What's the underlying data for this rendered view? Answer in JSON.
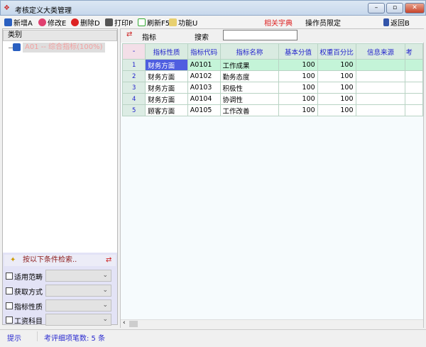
{
  "window": {
    "title": "考核定义大类管理"
  },
  "toolbar": {
    "add": "新增A",
    "edit": "修改E",
    "delete": "删除D",
    "print": "打印P",
    "refresh": "刷新F5",
    "func": "功能U",
    "dict": "相关字典",
    "operator": "操作员限定",
    "back": "返回B"
  },
  "left": {
    "header": "类别",
    "tree_item": "A01 -- 综合指标(100%)",
    "search_title": "按以下条件检索..",
    "filters": [
      {
        "label": "适用范畴"
      },
      {
        "label": "获取方式"
      },
      {
        "label": "指标性质"
      },
      {
        "label": "工资科目"
      }
    ]
  },
  "right": {
    "label": "指标",
    "search_label": "搜索",
    "search_value": ""
  },
  "grid": {
    "corner": "-",
    "columns": [
      "指标性质",
      "指标代码",
      "指标名称",
      "基本分值",
      "权重百分比",
      "信息来源",
      "考"
    ],
    "rows": [
      {
        "idx": "1",
        "nature": "财务方面",
        "code": "A0101",
        "name": "工作成果",
        "score": "100",
        "weight": "100",
        "source": ""
      },
      {
        "idx": "2",
        "nature": "财务方面",
        "code": "A0102",
        "name": "勤务态度",
        "score": "100",
        "weight": "100",
        "source": ""
      },
      {
        "idx": "3",
        "nature": "财务方面",
        "code": "A0103",
        "name": "积极性",
        "score": "100",
        "weight": "100",
        "source": ""
      },
      {
        "idx": "4",
        "nature": "财务方面",
        "code": "A0104",
        "name": "协调性",
        "score": "100",
        "weight": "100",
        "source": ""
      },
      {
        "idx": "5",
        "nature": "顾客方面",
        "code": "A0105",
        "name": "工作改善",
        "score": "100",
        "weight": "100",
        "source": ""
      }
    ]
  },
  "status": {
    "hint": "提示",
    "count": "考评细项笔数: 5 条"
  }
}
